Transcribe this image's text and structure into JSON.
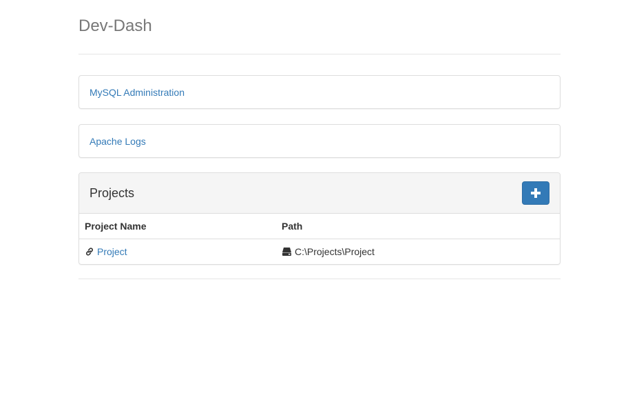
{
  "header": {
    "title": "Dev-Dash"
  },
  "links": [
    {
      "label": "MySQL Administration"
    },
    {
      "label": "Apache Logs"
    }
  ],
  "projects": {
    "title": "Projects",
    "add_button_icon": "plus-icon",
    "columns": [
      "Project Name",
      "Path"
    ],
    "rows": [
      {
        "name": "Project",
        "name_icon": "link-icon",
        "path": "C:\\Projects\\Project",
        "path_icon": "hdd-icon"
      }
    ]
  },
  "colors": {
    "link": "#337ab7",
    "primary_button": "#337ab7",
    "panel_heading_bg": "#f5f5f5",
    "title_text": "#777777"
  }
}
